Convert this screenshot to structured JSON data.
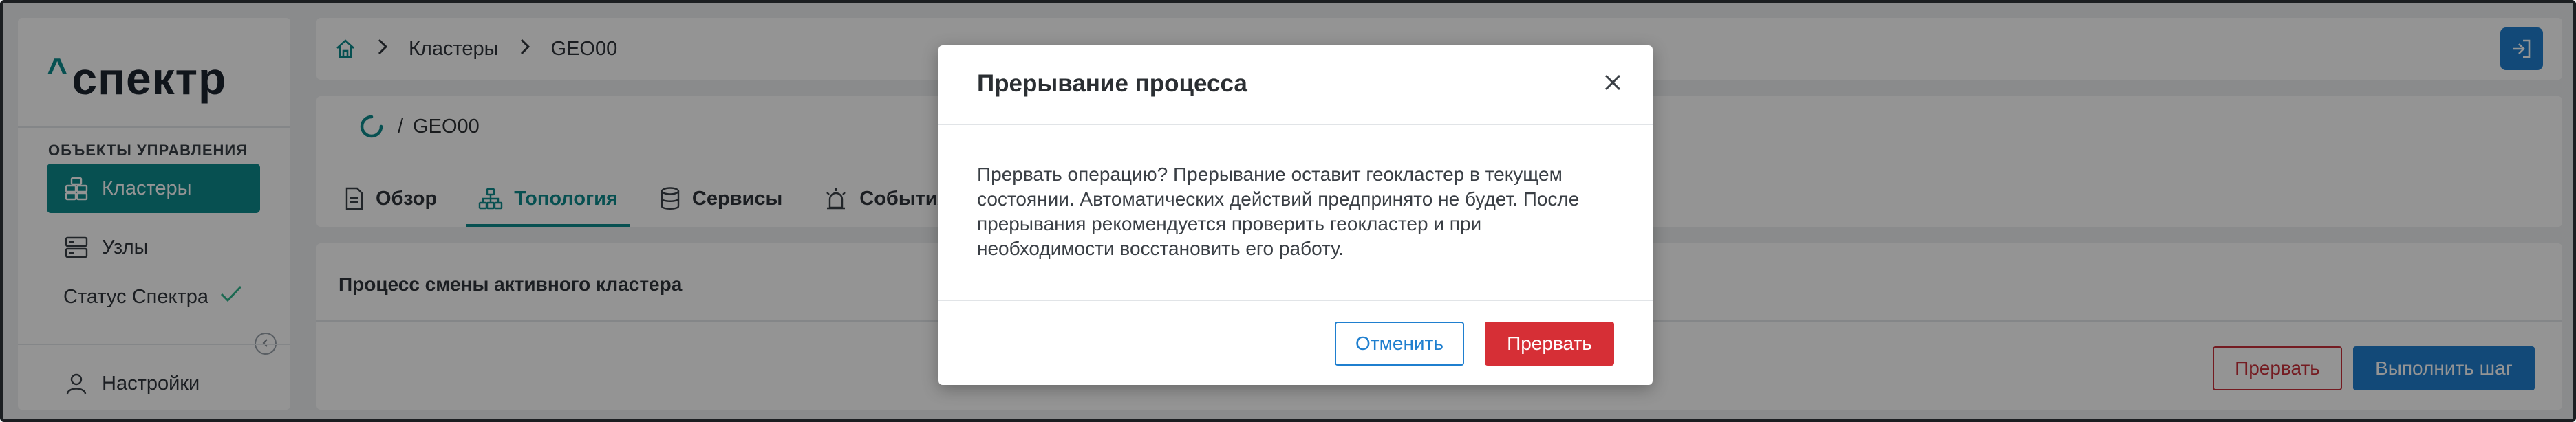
{
  "app": {
    "logo_caret": "^",
    "logo_text": "спектр"
  },
  "sidebar": {
    "section_title": "ОБЪЕКТЫ УПРАВЛЕНИЯ",
    "items": [
      {
        "label": "Кластеры",
        "icon": "clusters-icon",
        "active": true
      },
      {
        "label": "Узлы",
        "icon": "servers-icon",
        "active": false
      },
      {
        "label": "Статус Спектра",
        "icon": "check-icon",
        "active": false
      }
    ],
    "settings_label": "Настройки",
    "collapse_icon": "chevron-left-icon"
  },
  "breadcrumb": {
    "items": [
      "Кластеры",
      "GEO00"
    ],
    "home_icon": "home-icon"
  },
  "header": {
    "title_separator": "/",
    "title": "GEO00"
  },
  "tabs": [
    {
      "label": "Обзор",
      "icon": "document-icon",
      "active": false
    },
    {
      "label": "Топология",
      "icon": "topology-icon",
      "active": true
    },
    {
      "label": "Сервисы",
      "icon": "database-icon",
      "active": false
    },
    {
      "label": "События",
      "icon": "alarm-icon",
      "active": false
    }
  ],
  "process": {
    "title": "Процесс смены активного кластера",
    "abort_label": "Прервать",
    "step_label": "Выполнить шаг"
  },
  "modal": {
    "title": "Прерывание процесса",
    "body_lines": [
      "Прервать операцию? Прерывание оставит геокластер в текущем",
      "состоянии. Автоматических действий предпринято не будет. После",
      "прерывания рекомендуется проверить геокластер и при",
      "необходимости восстановить его работу."
    ],
    "cancel_label": "Отменить",
    "abort_label": "Прервать"
  },
  "colors": {
    "accent": "#0d8a8c",
    "primary": "#1f7fcf",
    "danger": "#d62f36",
    "success": "#2fb58c"
  }
}
